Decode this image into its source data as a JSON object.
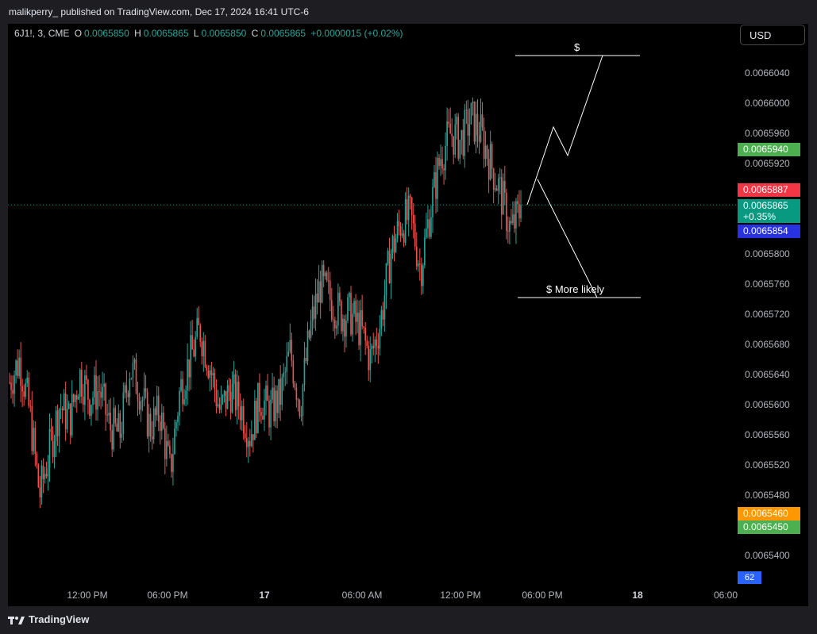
{
  "header": {
    "published": "malikperry_ published on TradingView.com, Dec 17, 2024 16:41 UTC-6"
  },
  "legend": {
    "symbol": "6J1!, 3, CME",
    "o_label": "O",
    "o_value": "0.0065850",
    "h_label": "H",
    "h_value": "0.0065865",
    "l_label": "L",
    "l_value": "0.0065850",
    "c_label": "C",
    "c_value": "0.0065865",
    "change": "+0.0000015 (+0.02%)"
  },
  "currency_button": "USD",
  "y_axis": {
    "ticks": [
      "0.0066040",
      "0.0066000",
      "0.0065960",
      "0.0065920",
      "0.0065800",
      "0.0065760",
      "0.0065720",
      "0.0065680",
      "0.0065640",
      "0.0065600",
      "0.0065560",
      "0.0065520",
      "0.0065480",
      "0.0065400"
    ],
    "ymin": 0.006538,
    "ymax": 0.006608
  },
  "price_tags": [
    {
      "label": "0.0065940",
      "color": "#4caf50"
    },
    {
      "label": "0.0065887",
      "color": "#f23645"
    },
    {
      "label": "0.0065865",
      "sub": "+0.35%",
      "color": "#089981"
    },
    {
      "label": "0.0065854",
      "color": "#2932e1"
    },
    {
      "label": "0.0065460",
      "color": "#ff9800"
    },
    {
      "label": "0.0065450",
      "color": "#4caf50"
    }
  ],
  "volume_badge": "62",
  "x_axis": {
    "ticks": [
      {
        "label": "12:00 PM",
        "bold": false
      },
      {
        "label": "06:00 PM",
        "bold": false
      },
      {
        "label": "17",
        "bold": true
      },
      {
        "label": "06:00 AM",
        "bold": false
      },
      {
        "label": "12:00 PM",
        "bold": false
      },
      {
        "label": "06:00 PM",
        "bold": false
      },
      {
        "label": "18",
        "bold": true
      },
      {
        "label": "06:00",
        "bold": false
      }
    ]
  },
  "annotations": {
    "target_up": "$",
    "target_down": "$ More likely"
  },
  "footer": {
    "brand": "TradingView"
  },
  "chart_data": {
    "type": "candlestick",
    "anchors": [
      [
        0.006563
      ],
      [
        0.006566
      ],
      [
        0.006559
      ],
      [
        0.006548
      ],
      [
        0.006554
      ],
      [
        0.00656
      ],
      [
        0.006558
      ],
      [
        0.006564
      ],
      [
        0.006561
      ],
      [
        0.006562
      ],
      [
        0.006557
      ],
      [
        0.006556
      ],
      [
        0.006565
      ],
      [
        0.006562
      ],
      [
        0.006557
      ],
      [
        0.006559
      ],
      [
        0.006551
      ],
      [
        0.006562
      ],
      [
        0.006566
      ],
      [
        0.00657
      ],
      [
        0.006565
      ],
      [
        0.006559
      ],
      [
        0.006562
      ],
      [
        0.00656
      ],
      [
        0.006556
      ],
      [
        0.006561
      ],
      [
        0.006559
      ],
      [
        0.006561
      ],
      [
        0.006567
      ],
      [
        0.00656
      ],
      [
        0.00657
      ],
      [
        0.006576
      ],
      [
        0.006574
      ],
      [
        0.006572
      ],
      [
        0.006572
      ],
      [
        0.00657
      ],
      [
        0.006566
      ],
      [
        0.006571
      ],
      [
        0.00658
      ],
      [
        0.006584
      ],
      [
        0.006585
      ],
      [
        0.006578
      ],
      [
        0.006586
      ],
      [
        0.006593
      ],
      [
        0.006596
      ],
      [
        0.006595
      ],
      [
        0.006598
      ],
      [
        0.006596
      ],
      [
        0.006592
      ],
      [
        0.006588
      ],
      [
        0.006583
      ],
      [
        0.006586
      ]
    ],
    "last": 0.0065865
  }
}
